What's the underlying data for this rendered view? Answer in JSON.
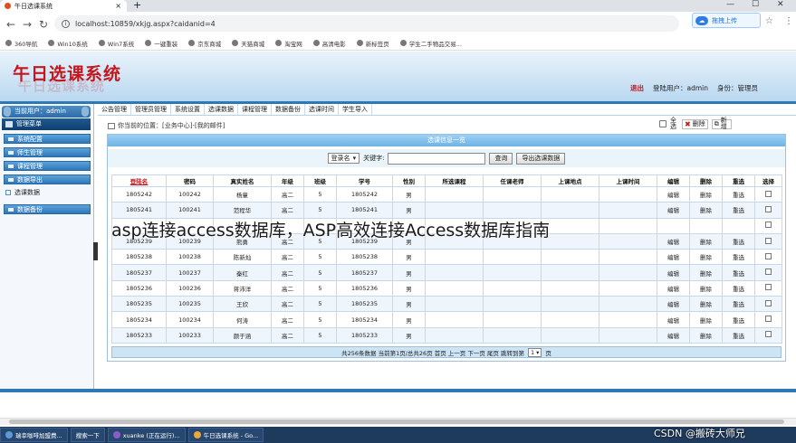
{
  "browser": {
    "tab_title": "午日选课系统",
    "url": "localhost:10859/xkjg.aspx?caidanid=4",
    "baidu_label": "拖拽上传",
    "bookmarks": [
      "360导航",
      "Win10系统",
      "Win7系统",
      "一键重装",
      "京东商城",
      "天猫商城",
      "淘宝网",
      "高清电影",
      "新标签页",
      "学生二手物品交易..."
    ]
  },
  "header": {
    "logo": "午日选课系统",
    "exit": "退出",
    "login_user": "登陆用户：admin",
    "role": "身份：管理员"
  },
  "sidebar": {
    "current_user": "当前用户：admin",
    "menu_title": "管理菜单",
    "items": [
      "系统配置",
      "师生管理",
      "课程管理",
      "数据导出"
    ],
    "sub_item": "选课数据",
    "last_item": "数据备份"
  },
  "top_tabs": [
    "公告管理",
    "管理员管理",
    "系统设置",
    "选课数据",
    "课程管理",
    "数据备份",
    "选课时间",
    "学生导入"
  ],
  "breadcrumb": "你当前的位置：[业务中心]-[我的邮件]",
  "ops": {
    "select_all": "全选",
    "delete": "删除",
    "add": "新增"
  },
  "panel_title": "选课信息一览",
  "search": {
    "field_select": "登录名",
    "keyword_label": "关键字:",
    "search_btn": "查询",
    "export_btn": "导出选课数据"
  },
  "table": {
    "headers": [
      "登陆名",
      "密码",
      "真实姓名",
      "年级",
      "班级",
      "学号",
      "性别",
      "所选课程",
      "任课老师",
      "上课地点",
      "上课时间",
      "编辑",
      "删除",
      "重选",
      "选择"
    ],
    "rows": [
      [
        "1805242",
        "100242",
        "杨童",
        "高二",
        "5",
        "1805242",
        "男"
      ],
      [
        "1805241",
        "100241",
        "范程华",
        "高二",
        "5",
        "1805241",
        "男"
      ],
      [
        "",
        "",
        "",
        "",
        "",
        "",
        ""
      ],
      [
        "1805239",
        "100239",
        "熊勇",
        "高二",
        "5",
        "1805239",
        "男"
      ],
      [
        "1805238",
        "100238",
        "陈新灿",
        "高二",
        "5",
        "1805238",
        "男"
      ],
      [
        "1805237",
        "100237",
        "秦红",
        "高二",
        "5",
        "1805237",
        "男"
      ],
      [
        "1805236",
        "100236",
        "蒋沛洋",
        "高二",
        "5",
        "1805236",
        "男"
      ],
      [
        "1805235",
        "100235",
        "王欣",
        "高二",
        "5",
        "1805235",
        "男"
      ],
      [
        "1805234",
        "100234",
        "何涛",
        "高二",
        "5",
        "1805234",
        "男"
      ],
      [
        "1805233",
        "100233",
        "颜于涵",
        "高二",
        "5",
        "1805233",
        "男"
      ]
    ],
    "edit": "编辑",
    "delete": "删除",
    "reselect": "重选"
  },
  "pager": {
    "summary": "共256条数据 当前第1页/总共26页 首页 上一页 下一页 尾页 跳转到第",
    "page": "1",
    "suffix": "页"
  },
  "overlay_text": "asp连接access数据库，ASP高效连接Access数据库指南",
  "taskbar": [
    "瑞幸咖啡加盟费...",
    "搜索一下",
    "xuanke (正在运行)...",
    "午日选课系统 - Go..."
  ],
  "watermark": "CSDN @搬砖大师兄"
}
